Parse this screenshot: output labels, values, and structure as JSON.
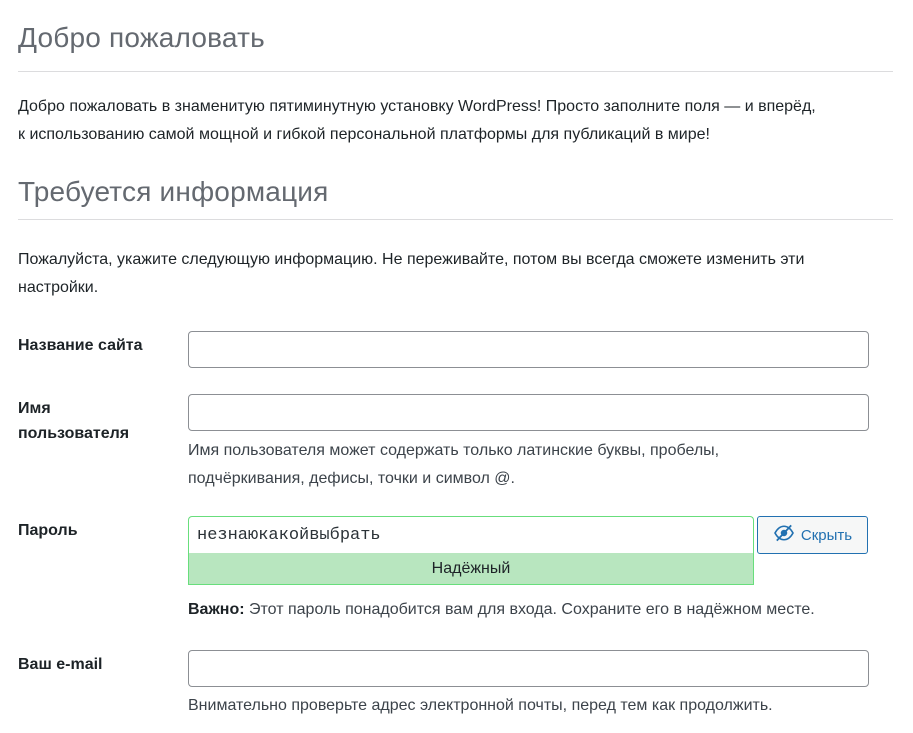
{
  "welcome": {
    "title": "Добро пожаловать",
    "text_line1": "Добро пожаловать в знаменитую пятиминутную установку WordPress! Просто заполните поля — и вперёд,",
    "text_line2": "к использованию самой мощной и гибкой персональной платформы для публикаций в мире!"
  },
  "info": {
    "title": "Требуется информация",
    "text_line1": "Пожалуйста, укажите следующую информацию. Не переживайте, потом вы всегда сможете изменить эти",
    "text_line2": "настройки."
  },
  "form": {
    "site_title": {
      "label": "Название сайта",
      "value": ""
    },
    "username": {
      "label_line1": "Имя",
      "label_line2": "пользователя",
      "value": "",
      "hint_line1": "Имя пользователя может содержать только латинские буквы, пробелы,",
      "hint_line2": "подчёркивания, дефисы, точки и символ @."
    },
    "password": {
      "label": "Пароль",
      "value": "незнаюкакойвыбрать",
      "hide_button": "Скрыть",
      "hide_icon": "eye-slash-icon",
      "strength": "Надёжный",
      "strength_color": "#b8e6bf",
      "note_bold": "Важно:",
      "note_text": " Этот пароль понадобится вам для входа. Сохраните его в надёжном месте."
    },
    "email": {
      "label": "Ваш e-mail",
      "value": "",
      "hint": "Внимательно проверьте адрес электронной почты, перед тем как продолжить."
    }
  },
  "colors": {
    "accent": "#2271b1",
    "strong_border": "#68de7c"
  }
}
